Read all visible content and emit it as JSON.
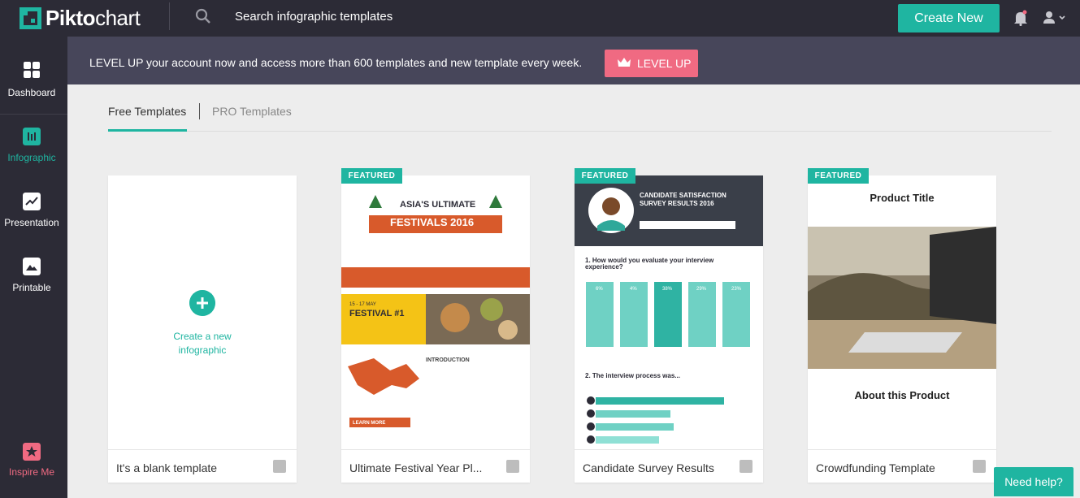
{
  "brand": {
    "logo": "Piktochart",
    "logo_bold": "Pikto",
    "logo_light": "chart"
  },
  "search": {
    "placeholder": "Search infographic templates"
  },
  "header": {
    "create_label": "Create New"
  },
  "sidebar": {
    "items": [
      {
        "label": "Dashboard",
        "icon": "dashboard-icon"
      },
      {
        "label": "Infographic",
        "icon": "infographic-icon"
      },
      {
        "label": "Presentation",
        "icon": "presentation-icon"
      },
      {
        "label": "Printable",
        "icon": "printable-icon"
      },
      {
        "label": "Inspire Me",
        "icon": "star-icon"
      }
    ]
  },
  "banner": {
    "text": "LEVEL UP your account now and access more than 600 templates and new template every week.",
    "button": "LEVEL UP"
  },
  "tabs": [
    {
      "label": "Free Templates",
      "active": true
    },
    {
      "label": "PRO Templates",
      "active": false
    }
  ],
  "cards": [
    {
      "title": "It's a blank template",
      "featured": false,
      "blank_line1": "Create a new",
      "blank_line2": "infographic"
    },
    {
      "title": "Ultimate Festival Year Pl...",
      "featured": true,
      "badge": "FEATURED",
      "preview": {
        "heading1": "ASIA'S ULTIMATE",
        "heading2": "FESTIVALS 2016",
        "festival": "FESTIVAL #1",
        "intro": "INTRODUCTION",
        "learn": "LEARN MORE",
        "date": "15 - 17 MAY"
      }
    },
    {
      "title": "Candidate Survey Results",
      "featured": true,
      "badge": "FEATURED",
      "preview": {
        "heading1": "CANDIDATE SATISFACTION",
        "heading2": "SURVEY RESULTS 2016",
        "q1": "1. How would you evaluate your interview experience?",
        "q2": "2. The interview process was...",
        "percents": [
          "6%",
          "4%",
          "38%",
          "29%",
          "23%"
        ]
      }
    },
    {
      "title": "Crowdfunding Template",
      "featured": true,
      "badge": "FEATURED",
      "preview": {
        "heading": "Product Title",
        "about": "About this Product"
      }
    }
  ],
  "help": {
    "label": "Need help?"
  },
  "colors": {
    "accent": "#1fb5a1",
    "dark": "#2c2b36",
    "banner": "#47465a",
    "pink": "#f06a82",
    "orange": "#d85a2b"
  }
}
